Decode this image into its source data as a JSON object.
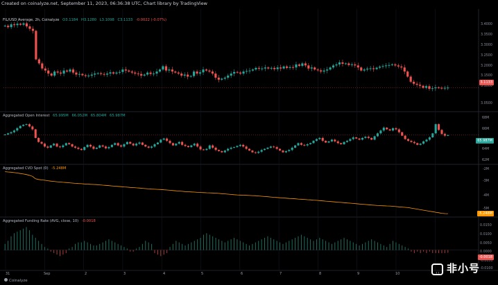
{
  "header": {
    "title": "Created on coinalyze.net, September 11, 2023, 06:36:38 UTC, Chart library by TradingView"
  },
  "panes": {
    "price": {
      "label": "FIL/USD Average, 2h, Coinalyze",
      "o": "O3.1184",
      "h": "H3.1280",
      "l": "L3.1098",
      "c": "C3.1133",
      "chg": "-0.0022 (-0.07%)",
      "badge": "3.1133",
      "ticks": [
        "3.4000",
        "3.3500",
        "3.3000",
        "3.2500",
        "3.2000",
        "3.1500",
        "3.1000",
        "3.0500"
      ]
    },
    "oi": {
      "label": "Aggregated Open Interest",
      "vals": [
        "65.995M",
        "66.052M",
        "65.804M",
        "65.987M"
      ],
      "badge": "65.987M",
      "ticks": [
        "68M",
        "66M",
        "64M",
        "62M"
      ]
    },
    "cvd": {
      "label": "Aggregated CVD Spot (0)",
      "val": "-5.248M",
      "badge": "-5.248M",
      "ticks": [
        "-2M",
        "-3M",
        "-4M",
        "-5M"
      ]
    },
    "fund": {
      "label": "Aggregated Funding Rate (AVG, close, 10)",
      "val": "-0.0018",
      "badge": "-0.0018",
      "ticks": [
        "0.0150",
        "0.0100",
        "0.0050",
        "0.0000",
        "-0.0050",
        "-0.0100"
      ]
    }
  },
  "xaxis": {
    "labels": [
      "31",
      "Sep",
      "2",
      "3",
      "4",
      "5",
      "6",
      "7",
      "8",
      "9",
      "10",
      "11"
    ]
  },
  "footer": {
    "brand": "Coinalyze"
  },
  "watermark": {
    "text": "非小号"
  },
  "colors": {
    "up": "#26a69a",
    "down": "#ef5350",
    "cvd": "#ff9800",
    "bg": "#000000"
  },
  "chart_data": [
    {
      "type": "candlestick",
      "title": "FIL/USD Average, 2h, Coinalyze",
      "ylim": [
        3.02,
        3.48
      ],
      "closes": [
        3.425,
        3.418,
        3.432,
        3.428,
        3.435,
        3.43,
        3.437,
        3.422,
        3.41,
        3.4,
        3.26,
        3.24,
        3.215,
        3.205,
        3.19,
        3.18,
        3.2,
        3.195,
        3.19,
        3.205,
        3.2,
        3.21,
        3.195,
        3.185,
        3.188,
        3.182,
        3.178,
        3.18,
        3.185,
        3.19,
        3.192,
        3.188,
        3.185,
        3.19,
        3.196,
        3.19,
        3.195,
        3.198,
        3.21,
        3.205,
        3.2,
        3.195,
        3.19,
        3.188,
        3.18,
        3.185,
        3.195,
        3.188,
        3.19,
        3.2,
        3.21,
        3.226,
        3.205,
        3.21,
        3.2,
        3.195,
        3.19,
        3.18,
        3.185,
        3.175,
        3.178,
        3.2,
        3.19,
        3.196,
        3.21,
        3.205,
        3.2,
        3.19,
        3.17,
        3.16,
        3.165,
        3.17,
        3.18,
        3.19,
        3.198,
        3.195,
        3.19,
        3.2,
        3.203,
        3.205,
        3.21,
        3.218,
        3.214,
        3.215,
        3.22,
        3.215,
        3.218,
        3.212,
        3.22,
        3.215,
        3.225,
        3.218,
        3.222,
        3.22,
        3.235,
        3.228,
        3.24,
        3.23,
        3.215,
        3.22,
        3.21,
        3.206,
        3.2,
        3.205,
        3.21,
        3.22,
        3.23,
        3.235,
        3.245,
        3.238,
        3.24,
        3.232,
        3.235,
        3.23,
        3.22,
        3.205,
        3.21,
        3.214,
        3.216,
        3.212,
        3.219,
        3.224,
        3.227,
        3.23,
        3.232,
        3.235,
        3.23,
        3.225,
        3.22,
        3.2,
        3.175,
        3.15,
        3.14,
        3.135,
        3.13,
        3.12,
        3.128,
        3.115,
        3.118,
        3.122,
        3.12,
        3.118,
        3.12,
        3.121
      ]
    },
    {
      "type": "candlestick",
      "title": "Aggregated Open Interest",
      "ylim": [
        61.5,
        69
      ],
      "closes": [
        66.1,
        66.3,
        66.5,
        66.8,
        67.2,
        67.6,
        67.8,
        67.9,
        67.5,
        67.0,
        65.5,
        64.8,
        64.5,
        64.0,
        63.8,
        64.2,
        64.5,
        64.0,
        63.9,
        64.2,
        64.6,
        64.4,
        64.0,
        63.8,
        63.6,
        63.4,
        63.9,
        64.3,
        64.0,
        63.6,
        63.8,
        64.2,
        64.0,
        63.7,
        63.9,
        64.3,
        64.6,
        64.2,
        64.0,
        64.4,
        64.8,
        64.5,
        64.2,
        64.5,
        64.7,
        64.3,
        64.0,
        63.8,
        64.0,
        64.4,
        64.7,
        65.2,
        65.4,
        65.0,
        64.6,
        64.2,
        64.5,
        64.8,
        64.3,
        64.1,
        63.9,
        64.2,
        64.5,
        64.0,
        63.5,
        63.4,
        63.6,
        64.2,
        63.8,
        63.4,
        63.2,
        63.0,
        63.3,
        63.6,
        63.8,
        63.9,
        64.1,
        64.3,
        64.0,
        63.6,
        63.3,
        63.0,
        62.9,
        63.1,
        63.4,
        63.6,
        63.8,
        64.0,
        63.9,
        63.6,
        63.3,
        63.0,
        63.2,
        63.4,
        63.8,
        64.2,
        64.6,
        64.3,
        64.2,
        64.4,
        64.6,
        65.0,
        65.3,
        65.5,
        65.0,
        64.7,
        64.9,
        65.2,
        64.9,
        64.6,
        64.4,
        64.8,
        65.0,
        65.3,
        65.6,
        65.4,
        65.2,
        65.5,
        65.7,
        65.5,
        65.2,
        65.8,
        66.3,
        66.8,
        67.3,
        67.0,
        66.8,
        67.2,
        67.0,
        66.5,
        65.9,
        65.3,
        65.0,
        64.8,
        64.6,
        64.3,
        64.5,
        64.9,
        65.2,
        65.6,
        66.3,
        67.9,
        66.9,
        66.2,
        65.9,
        66.0
      ]
    },
    {
      "type": "line",
      "title": "Aggregated CVD Spot (0)",
      "ylim": [
        -5.35,
        -1.7
      ],
      "values": [
        -2.0,
        -2.02,
        -2.04,
        -2.07,
        -2.1,
        -2.14,
        -2.18,
        -2.22,
        -2.28,
        -2.36,
        -2.55,
        -2.6,
        -2.64,
        -2.66,
        -2.7,
        -2.73,
        -2.75,
        -2.78,
        -2.8,
        -2.82,
        -2.84,
        -2.86,
        -2.88,
        -2.9,
        -2.92,
        -2.93,
        -2.95,
        -2.96,
        -2.98,
        -2.99,
        -3.0,
        -3.02,
        -3.04,
        -3.06,
        -3.08,
        -3.1,
        -3.12,
        -3.14,
        -3.16,
        -3.18,
        -3.2,
        -3.22,
        -3.23,
        -3.25,
        -3.27,
        -3.29,
        -3.31,
        -3.33,
        -3.35,
        -3.36,
        -3.37,
        -3.38,
        -3.4,
        -3.42,
        -3.44,
        -3.46,
        -3.48,
        -3.5,
        -3.52,
        -3.54,
        -3.55,
        -3.57,
        -3.58,
        -3.6,
        -3.61,
        -3.62,
        -3.63,
        -3.64,
        -3.65,
        -3.66,
        -3.68,
        -3.7,
        -3.72,
        -3.74,
        -3.76,
        -3.78,
        -3.8,
        -3.81,
        -3.82,
        -3.83,
        -3.84,
        -3.85,
        -3.86,
        -3.88,
        -3.9,
        -3.92,
        -3.94,
        -3.96,
        -3.98,
        -4.0,
        -4.02,
        -4.03,
        -4.05,
        -4.07,
        -4.08,
        -4.1,
        -4.12,
        -4.13,
        -4.15,
        -4.17,
        -4.18,
        -4.2,
        -4.22,
        -4.24,
        -4.26,
        -4.28,
        -4.3,
        -4.32,
        -4.34,
        -4.36,
        -4.38,
        -4.4,
        -4.42,
        -4.44,
        -4.46,
        -4.48,
        -4.5,
        -4.52,
        -4.54,
        -4.56,
        -4.58,
        -4.6,
        -4.62,
        -4.63,
        -4.64,
        -4.65,
        -4.66,
        -4.68,
        -4.7,
        -4.72,
        -4.74,
        -4.76,
        -4.78,
        -4.82,
        -4.86,
        -4.9,
        -4.94,
        -4.98,
        -5.02,
        -5.06,
        -5.1,
        -5.14,
        -5.18,
        -5.22,
        -5.24,
        -5.248
      ]
    },
    {
      "type": "bar",
      "title": "Aggregated Funding Rate (AVG, close, 10)",
      "ylim": [
        -0.012,
        0.0175
      ],
      "values": [
        0.004,
        0.006,
        0.009,
        0.011,
        0.012,
        0.013,
        0.014,
        0.015,
        0.013,
        0.01,
        0.008,
        0.006,
        0.004,
        0.002,
        0.001,
        -0.001,
        -0.002,
        -0.003,
        -0.004,
        -0.003,
        -0.002,
        0.001,
        0.002,
        0.004,
        0.005,
        0.005,
        0.006,
        0.005,
        0.004,
        0.003,
        0.003,
        0.004,
        0.005,
        0.006,
        0.007,
        0.006,
        0.005,
        0.004,
        0.003,
        0.002,
        0.001,
        -0.001,
        -0.001,
        0.001,
        0.002,
        0.004,
        0.006,
        0.005,
        0.004,
        -0.002,
        -0.003,
        -0.004,
        -0.003,
        -0.002,
        0.002,
        0.004,
        0.006,
        0.005,
        0.004,
        0.003,
        0.004,
        0.005,
        0.006,
        0.007,
        0.008,
        0.01,
        0.011,
        0.01,
        0.009,
        0.008,
        0.007,
        0.006,
        0.005,
        0.006,
        0.007,
        0.008,
        0.007,
        0.006,
        0.005,
        0.004,
        0.003,
        0.004,
        0.005,
        0.006,
        0.007,
        0.008,
        0.009,
        0.008,
        0.007,
        0.006,
        0.005,
        0.004,
        0.005,
        0.006,
        0.007,
        0.008,
        0.009,
        0.01,
        0.009,
        0.008,
        0.007,
        0.006,
        0.007,
        0.008,
        0.007,
        0.006,
        0.005,
        0.004,
        0.005,
        0.006,
        0.007,
        0.008,
        0.007,
        0.006,
        0.005,
        0.004,
        0.003,
        0.004,
        0.005,
        0.006,
        0.007,
        0.006,
        0.005,
        0.004,
        0.003,
        0.002,
        0.004,
        0.006,
        0.005,
        0.004,
        0.003,
        0.002,
        0.001,
        -0.001,
        -0.002,
        -0.001,
        -0.002,
        -0.001,
        -0.002,
        -0.001,
        -0.002,
        -0.002,
        -0.002,
        -0.002,
        -0.002,
        -0.0018
      ]
    }
  ]
}
